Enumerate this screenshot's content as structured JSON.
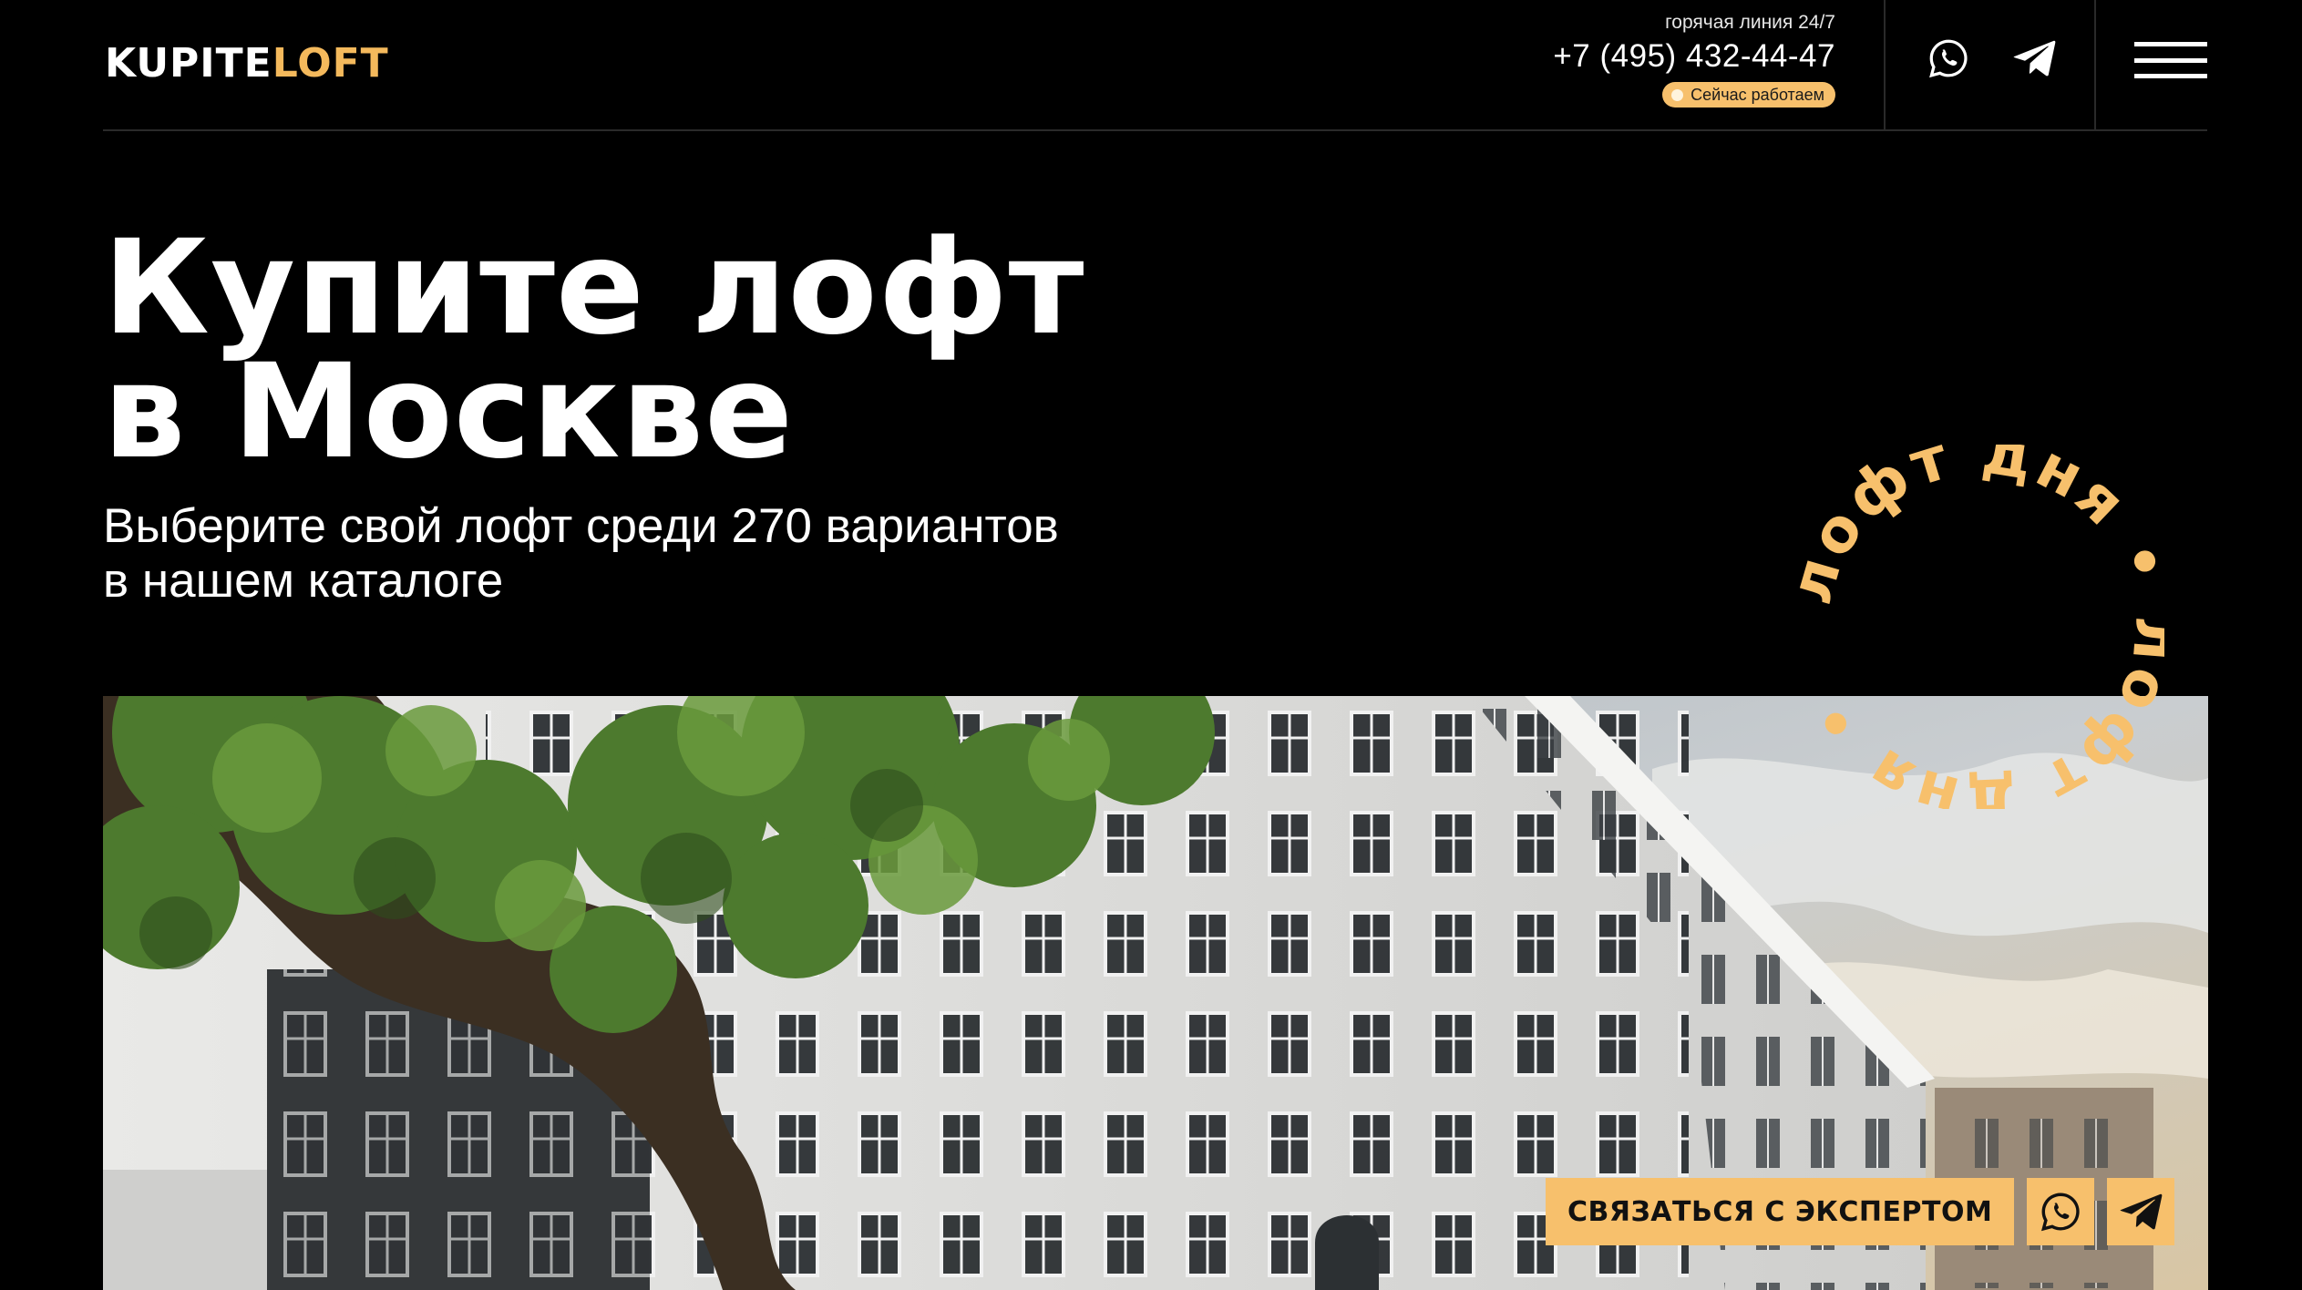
{
  "brand": {
    "logo_part1": "KUPITE",
    "logo_part2": "LOFT"
  },
  "contact": {
    "hotline_label": "горячая линия 24/7",
    "phone": "+7 (495) 432-44-47",
    "status": "Сейчас работаем"
  },
  "header_icons": [
    "whatsapp-icon",
    "telegram-icon",
    "menu-icon"
  ],
  "hero": {
    "title_line1": "Купите лофт",
    "title_line2": "в Москве",
    "subtitle_line1": "Выберите свой лофт среди 270 вариантов",
    "subtitle_line2": "в нашем каталоге"
  },
  "badge": {
    "text": "лофт дня • лофт дня • "
  },
  "cta": {
    "label": "СВЯЗАТЬСЯ С ЭКСПЕРТОМ"
  },
  "colors": {
    "accent": "#f7c06c",
    "background": "#000000",
    "text": "#ffffff"
  }
}
